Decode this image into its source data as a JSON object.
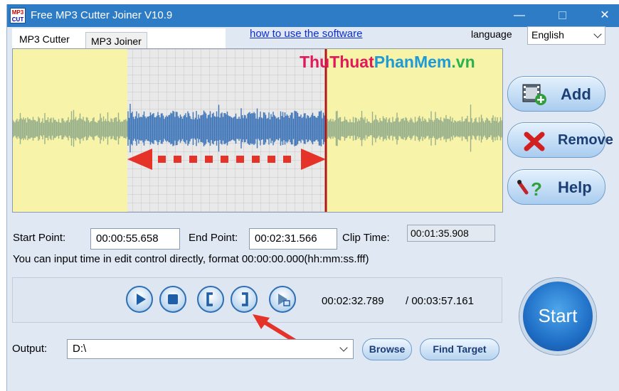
{
  "titlebar": {
    "icon_top": "MP3",
    "icon_bottom": "CUT",
    "title": "Free MP3 Cutter Joiner V10.9",
    "min_label": "—",
    "close_label": "✕"
  },
  "tabs": [
    {
      "label": "MP3 Cutter",
      "active": true
    },
    {
      "label": "MP3 Joiner",
      "active": false
    }
  ],
  "help_link": "how to use the software",
  "language": {
    "label": "language",
    "selected": "English"
  },
  "watermark": {
    "part1": "ThuThuat",
    "part2": "PhanMem",
    "part3": ".vn"
  },
  "side_buttons": {
    "add": "Add",
    "remove": "Remove",
    "help": "Help"
  },
  "times": {
    "start_label": "Start Point:",
    "start_value": "00:00:55.658",
    "end_label": "End Point:",
    "end_value": "00:02:31.566",
    "clip_label": "Clip Time:",
    "clip_value": "00:01:35.908"
  },
  "hint": "You can input time in edit control directly, format 00:00:00.000(hh:mm:ss.fff)",
  "player": {
    "current_time": "00:02:32.789",
    "total_time": "/ 00:03:57.161",
    "buttons": [
      "play-icon",
      "stop-icon",
      "mark-start-icon",
      "mark-end-icon",
      "play-selection-icon"
    ]
  },
  "start_button": "Start",
  "output": {
    "label": "Output:",
    "value": "D:\\",
    "browse": "Browse",
    "find_target": "Find Target"
  },
  "colors": {
    "titlebar": "#2e7cc6",
    "window_bg": "#dfe8f3",
    "selection_wave": "#3f76b8",
    "outside_wave": "#98b08c",
    "marker": "#b01818",
    "annotation_arrow": "#e5332a"
  }
}
